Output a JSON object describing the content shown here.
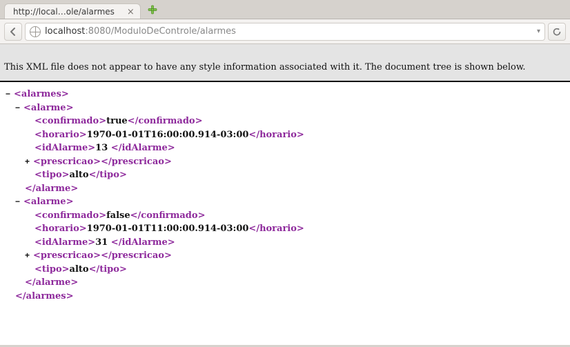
{
  "tab": {
    "title": "http://local…ole/alarmes",
    "close_glyph": "×"
  },
  "url": {
    "host": "localhost",
    "port_path": ":8080/ModuloDeControle/alarmes"
  },
  "notice": "This XML file does not appear to have any style information associated with it. The document tree is shown below.",
  "xml": {
    "root": "alarmes",
    "alarme_tag": "alarme",
    "fields": {
      "confirmado": "confirmado",
      "horario": "horario",
      "idAlarme": "idAlarme",
      "prescricao": "prescricao",
      "tipo": "tipo"
    },
    "items": [
      {
        "confirmado": "true",
        "horario": "1970-01-01T16:00:00.914-03:00",
        "idAlarme": "13 ",
        "tipo": "alto"
      },
      {
        "confirmado": "false",
        "horario": "1970-01-01T11:00:00.914-03:00",
        "idAlarme": "31 ",
        "tipo": "alto"
      }
    ]
  },
  "toggles": {
    "minus": "−",
    "plus": "+"
  }
}
